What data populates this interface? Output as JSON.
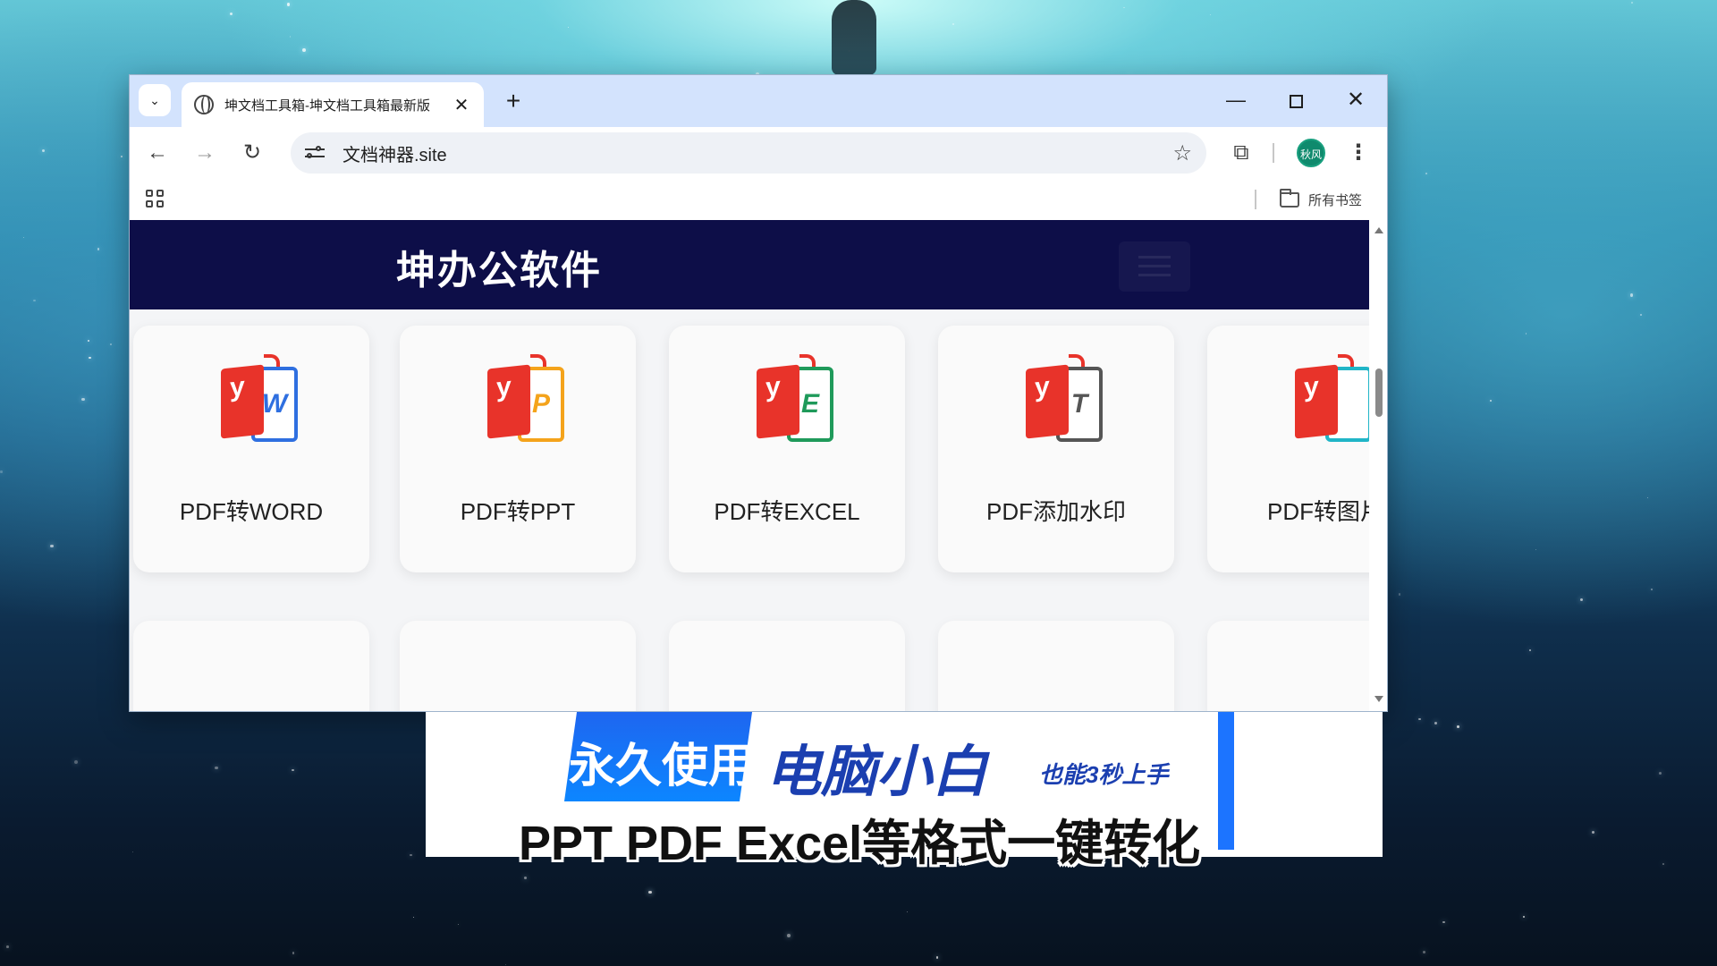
{
  "browser": {
    "tab_title": "坤文档工具箱-坤文档工具箱最新版",
    "tab_close": "✕",
    "new_tab": "+",
    "url": "文档神器.site",
    "avatar_text": "秋风",
    "bookmarks_all": "所有书签"
  },
  "site": {
    "logo": "坤办公软件",
    "cards": [
      {
        "label": "PDF转WORD",
        "letter": "W",
        "color": "#2f6fe0"
      },
      {
        "label": "PDF转PPT",
        "letter": "P",
        "color": "#f4a31b"
      },
      {
        "label": "PDF转EXCEL",
        "letter": "E",
        "color": "#1f9a5a"
      },
      {
        "label": "PDF添加水印",
        "letter": "T",
        "color": "#555555"
      },
      {
        "label": "PDF转图片",
        "letter": "",
        "color": "#20b5c7"
      }
    ]
  },
  "banner": {
    "blue_text": "永久使用",
    "main_text": "电脑小白",
    "sub_text": "也能3秒上手"
  },
  "caption": "PPT PDF Excel等格式一键转化"
}
